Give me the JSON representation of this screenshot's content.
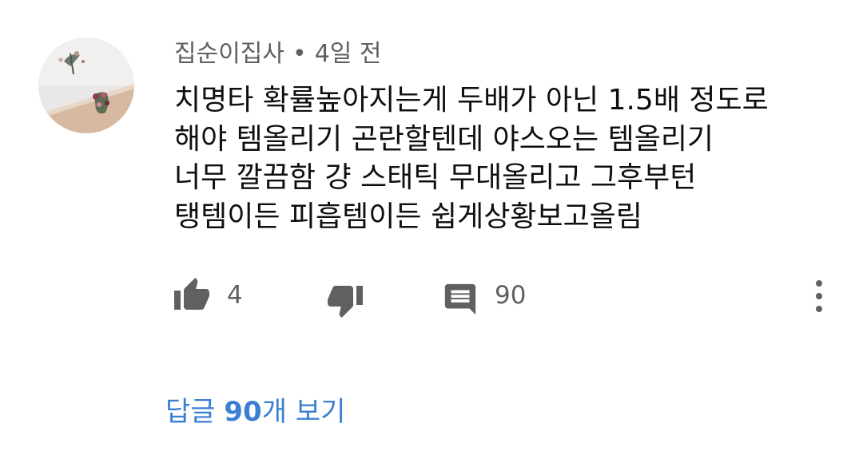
{
  "comment": {
    "author": "집순이집사",
    "separator": "•",
    "time": "4일 전",
    "body_lines": [
      "치명타 확률높아지는게 두배가 아닌 1.5배 정도로",
      "해야 템올리기 곤란할텐데 야스오는 템올리기",
      "너무 깔끔함 걍 스태틱 무대올리고 그후부턴",
      "탱템이든 피흡템이든 쉽게상황보고올림"
    ],
    "likes": "4",
    "replies_count": "90",
    "view_replies": {
      "prefix": "답글 ",
      "count": "90",
      "suffix": "개 보기"
    }
  },
  "icons": {
    "like": "thumb-up-icon",
    "dislike": "thumb-down-icon",
    "reply": "comment-icon",
    "more": "more-vert-icon"
  },
  "colors": {
    "text_primary": "#0f0f0f",
    "text_secondary": "#606060",
    "icon": "#606060",
    "link_blue": "#3b7fd3"
  }
}
